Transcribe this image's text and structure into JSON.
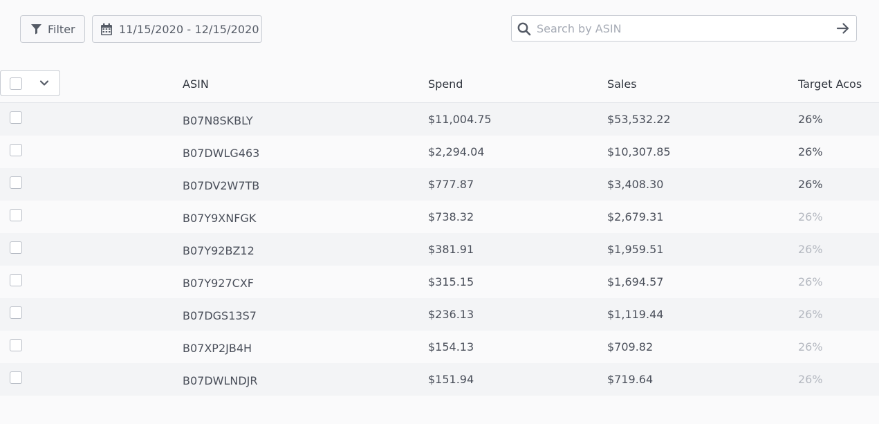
{
  "toolbar": {
    "filter_label": "Filter",
    "date_range": "11/15/2020 - 12/15/2020"
  },
  "search": {
    "placeholder": "Search by ASIN",
    "value": ""
  },
  "table": {
    "columns": {
      "asin": "ASIN",
      "spend": "Spend",
      "sales": "Sales",
      "target_acos": "Target Acos"
    },
    "rows": [
      {
        "asin": "B07N8SKBLY",
        "spend": "$11,004.75",
        "sales": "$53,532.22",
        "target_acos": "26%",
        "acos_muted": false
      },
      {
        "asin": "B07DWLG463",
        "spend": "$2,294.04",
        "sales": "$10,307.85",
        "target_acos": "26%",
        "acos_muted": false
      },
      {
        "asin": "B07DV2W7TB",
        "spend": "$777.87",
        "sales": "$3,408.30",
        "target_acos": "26%",
        "acos_muted": false
      },
      {
        "asin": "B07Y9XNFGK",
        "spend": "$738.32",
        "sales": "$2,679.31",
        "target_acos": "26%",
        "acos_muted": true
      },
      {
        "asin": "B07Y92BZ12",
        "spend": "$381.91",
        "sales": "$1,959.51",
        "target_acos": "26%",
        "acos_muted": true
      },
      {
        "asin": "B07Y927CXF",
        "spend": "$315.15",
        "sales": "$1,694.57",
        "target_acos": "26%",
        "acos_muted": true
      },
      {
        "asin": "B07DGS13S7",
        "spend": "$236.13",
        "sales": "$1,119.44",
        "target_acos": "26%",
        "acos_muted": true
      },
      {
        "asin": "B07XP2JB4H",
        "spend": "$154.13",
        "sales": "$709.82",
        "target_acos": "26%",
        "acos_muted": true
      },
      {
        "asin": "B07DWLNDJR",
        "spend": "$151.94",
        "sales": "$719.64",
        "target_acos": "26%",
        "acos_muted": true
      }
    ]
  },
  "icons": {
    "filter": "filter-icon",
    "calendar": "calendar-icon",
    "search": "search-icon",
    "submit": "arrow-right-icon",
    "dropdown": "chevron-down-icon"
  },
  "colors": {
    "muted_acos": "#b4b8c0",
    "icon": "#555b66"
  }
}
